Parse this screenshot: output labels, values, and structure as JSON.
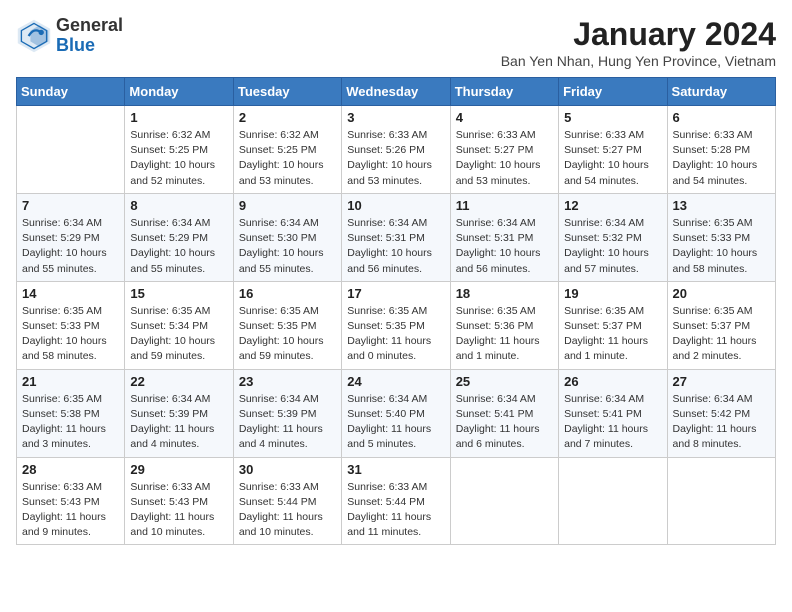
{
  "logo": {
    "general": "General",
    "blue": "Blue"
  },
  "header": {
    "month": "January 2024",
    "location": "Ban Yen Nhan, Hung Yen Province, Vietnam"
  },
  "weekdays": [
    "Sunday",
    "Monday",
    "Tuesday",
    "Wednesday",
    "Thursday",
    "Friday",
    "Saturday"
  ],
  "weeks": [
    [
      {
        "day": "",
        "info": ""
      },
      {
        "day": "1",
        "info": "Sunrise: 6:32 AM\nSunset: 5:25 PM\nDaylight: 10 hours\nand 52 minutes."
      },
      {
        "day": "2",
        "info": "Sunrise: 6:32 AM\nSunset: 5:25 PM\nDaylight: 10 hours\nand 53 minutes."
      },
      {
        "day": "3",
        "info": "Sunrise: 6:33 AM\nSunset: 5:26 PM\nDaylight: 10 hours\nand 53 minutes."
      },
      {
        "day": "4",
        "info": "Sunrise: 6:33 AM\nSunset: 5:27 PM\nDaylight: 10 hours\nand 53 minutes."
      },
      {
        "day": "5",
        "info": "Sunrise: 6:33 AM\nSunset: 5:27 PM\nDaylight: 10 hours\nand 54 minutes."
      },
      {
        "day": "6",
        "info": "Sunrise: 6:33 AM\nSunset: 5:28 PM\nDaylight: 10 hours\nand 54 minutes."
      }
    ],
    [
      {
        "day": "7",
        "info": "Sunrise: 6:34 AM\nSunset: 5:29 PM\nDaylight: 10 hours\nand 55 minutes."
      },
      {
        "day": "8",
        "info": "Sunrise: 6:34 AM\nSunset: 5:29 PM\nDaylight: 10 hours\nand 55 minutes."
      },
      {
        "day": "9",
        "info": "Sunrise: 6:34 AM\nSunset: 5:30 PM\nDaylight: 10 hours\nand 55 minutes."
      },
      {
        "day": "10",
        "info": "Sunrise: 6:34 AM\nSunset: 5:31 PM\nDaylight: 10 hours\nand 56 minutes."
      },
      {
        "day": "11",
        "info": "Sunrise: 6:34 AM\nSunset: 5:31 PM\nDaylight: 10 hours\nand 56 minutes."
      },
      {
        "day": "12",
        "info": "Sunrise: 6:34 AM\nSunset: 5:32 PM\nDaylight: 10 hours\nand 57 minutes."
      },
      {
        "day": "13",
        "info": "Sunrise: 6:35 AM\nSunset: 5:33 PM\nDaylight: 10 hours\nand 58 minutes."
      }
    ],
    [
      {
        "day": "14",
        "info": "Sunrise: 6:35 AM\nSunset: 5:33 PM\nDaylight: 10 hours\nand 58 minutes."
      },
      {
        "day": "15",
        "info": "Sunrise: 6:35 AM\nSunset: 5:34 PM\nDaylight: 10 hours\nand 59 minutes."
      },
      {
        "day": "16",
        "info": "Sunrise: 6:35 AM\nSunset: 5:35 PM\nDaylight: 10 hours\nand 59 minutes."
      },
      {
        "day": "17",
        "info": "Sunrise: 6:35 AM\nSunset: 5:35 PM\nDaylight: 11 hours\nand 0 minutes."
      },
      {
        "day": "18",
        "info": "Sunrise: 6:35 AM\nSunset: 5:36 PM\nDaylight: 11 hours\nand 1 minute."
      },
      {
        "day": "19",
        "info": "Sunrise: 6:35 AM\nSunset: 5:37 PM\nDaylight: 11 hours\nand 1 minute."
      },
      {
        "day": "20",
        "info": "Sunrise: 6:35 AM\nSunset: 5:37 PM\nDaylight: 11 hours\nand 2 minutes."
      }
    ],
    [
      {
        "day": "21",
        "info": "Sunrise: 6:35 AM\nSunset: 5:38 PM\nDaylight: 11 hours\nand 3 minutes."
      },
      {
        "day": "22",
        "info": "Sunrise: 6:34 AM\nSunset: 5:39 PM\nDaylight: 11 hours\nand 4 minutes."
      },
      {
        "day": "23",
        "info": "Sunrise: 6:34 AM\nSunset: 5:39 PM\nDaylight: 11 hours\nand 4 minutes."
      },
      {
        "day": "24",
        "info": "Sunrise: 6:34 AM\nSunset: 5:40 PM\nDaylight: 11 hours\nand 5 minutes."
      },
      {
        "day": "25",
        "info": "Sunrise: 6:34 AM\nSunset: 5:41 PM\nDaylight: 11 hours\nand 6 minutes."
      },
      {
        "day": "26",
        "info": "Sunrise: 6:34 AM\nSunset: 5:41 PM\nDaylight: 11 hours\nand 7 minutes."
      },
      {
        "day": "27",
        "info": "Sunrise: 6:34 AM\nSunset: 5:42 PM\nDaylight: 11 hours\nand 8 minutes."
      }
    ],
    [
      {
        "day": "28",
        "info": "Sunrise: 6:33 AM\nSunset: 5:43 PM\nDaylight: 11 hours\nand 9 minutes."
      },
      {
        "day": "29",
        "info": "Sunrise: 6:33 AM\nSunset: 5:43 PM\nDaylight: 11 hours\nand 10 minutes."
      },
      {
        "day": "30",
        "info": "Sunrise: 6:33 AM\nSunset: 5:44 PM\nDaylight: 11 hours\nand 10 minutes."
      },
      {
        "day": "31",
        "info": "Sunrise: 6:33 AM\nSunset: 5:44 PM\nDaylight: 11 hours\nand 11 minutes."
      },
      {
        "day": "",
        "info": ""
      },
      {
        "day": "",
        "info": ""
      },
      {
        "day": "",
        "info": ""
      }
    ]
  ]
}
